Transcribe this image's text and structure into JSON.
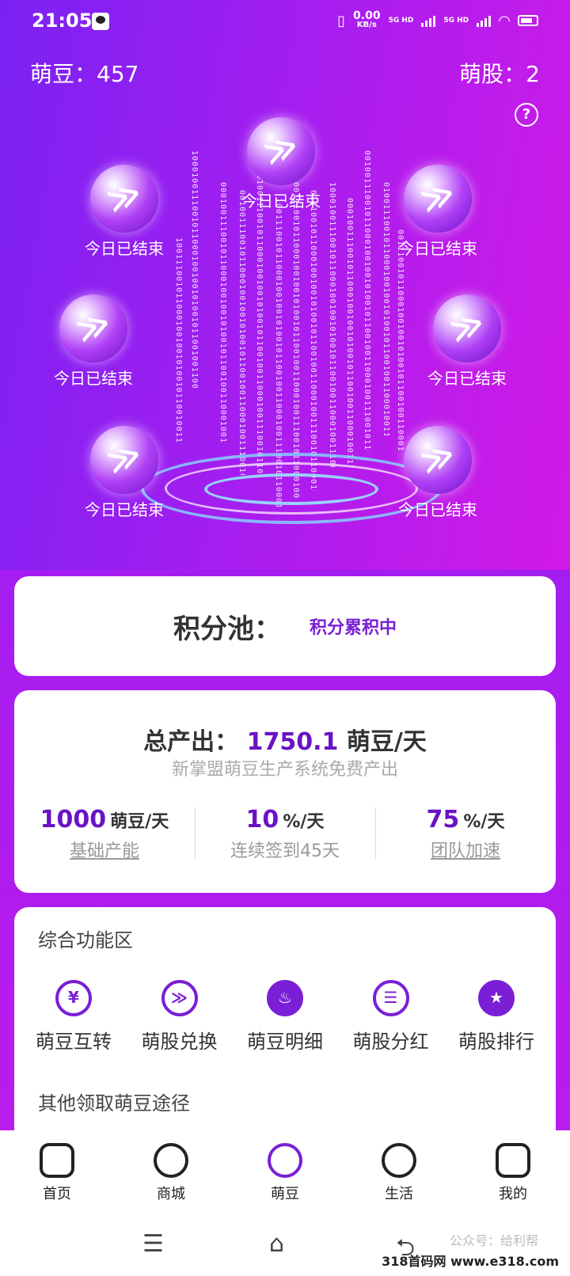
{
  "status_bar": {
    "time": "21:05",
    "net_speed": "0.00",
    "net_unit": "KB/s",
    "sim1": "5G HD",
    "sim2": "5G HD"
  },
  "header": {
    "beans_label": "萌豆：",
    "beans_value": "457",
    "shares_label": "萌股：",
    "shares_value": "2",
    "help": "?"
  },
  "bubbles": [
    {
      "label": "今日已结束"
    },
    {
      "label": "今日已结束"
    },
    {
      "label": "今日已结束"
    },
    {
      "label": "今日已结束"
    },
    {
      "label": "今日已结束"
    },
    {
      "label": "今日已结束"
    },
    {
      "label": "今日已结束"
    }
  ],
  "binary_text": "1000100111001011000100100101001011001001",
  "pool": {
    "label": "积分池：",
    "status": "积分累积中"
  },
  "output": {
    "total_label": "总产出：",
    "total_value": "1750.1",
    "total_unit": "萌豆/天",
    "subtitle": "新掌盟萌豆生产系统免费产出",
    "stats": [
      {
        "value": "1000",
        "unit": "萌豆/天",
        "caption": "基础产能"
      },
      {
        "value": "10",
        "unit": "%/天",
        "caption": "连续签到45天"
      },
      {
        "value": "75",
        "unit": "%/天",
        "caption": "团队加速"
      }
    ]
  },
  "functions": {
    "title": "综合功能区",
    "items": [
      {
        "name": "萌豆互转",
        "icon": "exchange-icon",
        "glyph": "¥"
      },
      {
        "name": "萌股兑换",
        "icon": "share-exchange-icon",
        "glyph": "≫"
      },
      {
        "name": "萌豆明细",
        "icon": "flame-icon",
        "glyph": "♨"
      },
      {
        "name": "萌股分红",
        "icon": "dividend-icon",
        "glyph": "☰"
      },
      {
        "name": "萌股排行",
        "icon": "medal-icon",
        "glyph": "★"
      }
    ],
    "other_title": "其他领取萌豆途径"
  },
  "tabs": [
    {
      "label": "首页",
      "icon": "home-icon"
    },
    {
      "label": "商城",
      "icon": "cart-icon"
    },
    {
      "label": "萌豆",
      "icon": "bean-icon"
    },
    {
      "label": "生活",
      "icon": "life-icon"
    },
    {
      "label": "我的",
      "icon": "profile-icon"
    }
  ],
  "nav": {
    "menu": "☰",
    "home": "⌂",
    "back": "⮌"
  },
  "watermark": {
    "text1": "公众号：给利帮",
    "text2": "318首码网 www.e318.com"
  },
  "colors": {
    "accent": "#7a1fd6",
    "hero_start": "#7a22f2",
    "hero_end": "#d21ae6"
  }
}
